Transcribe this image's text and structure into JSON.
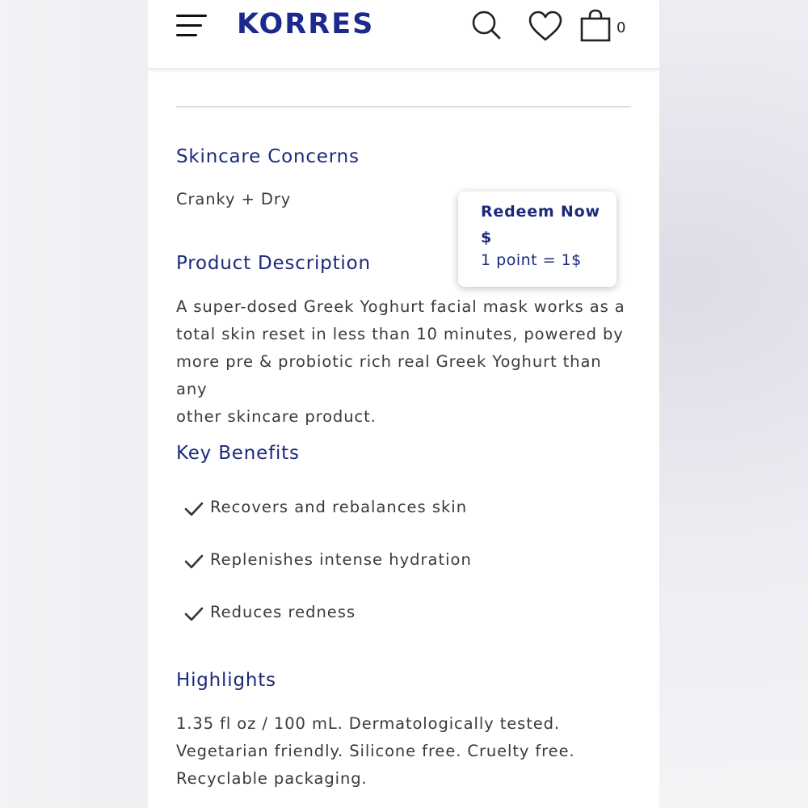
{
  "header": {
    "logo": "KORRES",
    "cart_count": "0"
  },
  "sections": {
    "skincare_concerns": {
      "title": "Skincare Concerns",
      "value": "Cranky + Dry"
    },
    "product_description": {
      "title": "Product Description",
      "lines": [
        "A super-dosed Greek Yoghurt facial mask works as a",
        "total skin reset in less than 10 minutes, powered by",
        "more pre & probiotic rich real Greek Yoghurt than any",
        "other skincare product."
      ]
    },
    "key_benefits": {
      "title": "Key Benefits",
      "items": [
        "Recovers and rebalances skin",
        "Replenishes intense hydration",
        "Reduces redness"
      ]
    },
    "highlights": {
      "title": "Highlights",
      "lines": [
        "1.35 fl oz / 100 mL. Dermatologically tested.",
        "Vegetarian friendly. Silicone free. Cruelty free.",
        "Recyclable packaging."
      ]
    }
  },
  "redeem_popup": {
    "title": "Redeem Now",
    "symbol": "$",
    "rate": "1 point = 1$"
  },
  "colors": {
    "brand": "#1b2a8c",
    "heading": "#1b2a7a",
    "body_text": "#3a3a3a"
  },
  "icons": [
    "menu-icon",
    "search-icon",
    "heart-icon",
    "shopping-bag-icon",
    "check-icon"
  ]
}
